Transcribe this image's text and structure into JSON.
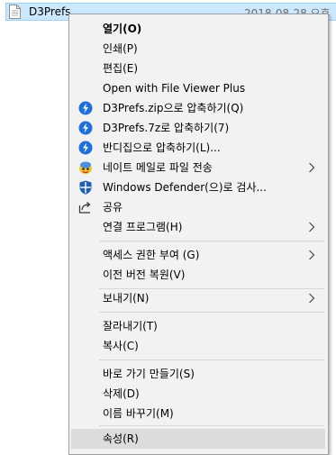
{
  "file": {
    "name": "D3Prefs",
    "date": "2018-08-28 오후"
  },
  "menu": {
    "items": [
      {
        "label": "열기(O)"
      },
      {
        "label": "인쇄(P)"
      },
      {
        "label": "편집(E)"
      },
      {
        "label": "Open with File Viewer Plus"
      },
      {
        "label": "D3Prefs.zip으로 압축하기(Q)",
        "icon": "bandizip-icon"
      },
      {
        "label": "D3Prefs.7z로 압축하기(7)",
        "icon": "bandizip-icon"
      },
      {
        "label": "반디집으로 압축하기(L)...",
        "icon": "bandizip-icon"
      },
      {
        "label": "네이트 메일로 파일 전송",
        "icon": "nate-mail-icon"
      },
      {
        "label": "Windows Defender(으)로 검사...",
        "icon": "windows-defender-shield-icon"
      },
      {
        "label": "공유",
        "icon": "share-icon"
      },
      {
        "label": "연결 프로그램(H)"
      },
      {
        "label": "액세스 권한 부여 (G)"
      },
      {
        "label": "이전 버전 복원(V)"
      },
      {
        "label": "보내기(N)"
      },
      {
        "label": "잘라내기(T)"
      },
      {
        "label": "복사(C)"
      },
      {
        "label": "바로 가기 만들기(S)"
      },
      {
        "label": "삭제(D)"
      },
      {
        "label": "이름 바꾸기(M)"
      },
      {
        "label": "속성(R)"
      }
    ]
  },
  "colors": {
    "selection": "#cce8ff",
    "menu_bg": "#f2f2f2",
    "hover": "#dcdcdc",
    "bandizip": "#1e6fd9"
  }
}
